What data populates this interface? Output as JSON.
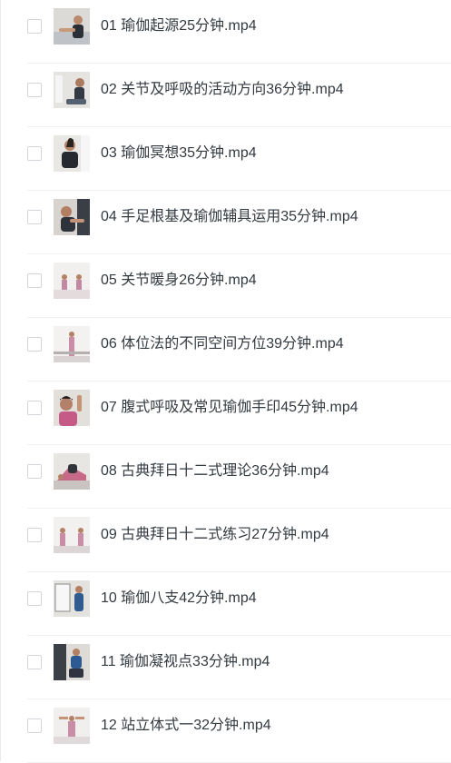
{
  "files": [
    {
      "name": "01 瑜伽起源25分钟.mp4",
      "thumb": "yoga-video-thumbnail"
    },
    {
      "name": "02 关节及呼吸的活动方向36分钟.mp4",
      "thumb": "yoga-video-thumbnail"
    },
    {
      "name": "03 瑜伽冥想35分钟.mp4",
      "thumb": "yoga-video-thumbnail"
    },
    {
      "name": "04 手足根基及瑜伽辅具运用35分钟.mp4",
      "thumb": "yoga-video-thumbnail"
    },
    {
      "name": "05 关节暖身26分钟.mp4",
      "thumb": "yoga-video-thumbnail"
    },
    {
      "name": "06 体位法的不同空间方位39分钟.mp4",
      "thumb": "yoga-video-thumbnail"
    },
    {
      "name": "07 腹式呼吸及常见瑜伽手印45分钟.mp4",
      "thumb": "yoga-video-thumbnail"
    },
    {
      "name": "08 古典拜日十二式理论36分钟.mp4",
      "thumb": "yoga-video-thumbnail"
    },
    {
      "name": "09 古典拜日十二式练习27分钟.mp4",
      "thumb": "yoga-video-thumbnail"
    },
    {
      "name": "10 瑜伽八支42分钟.mp4",
      "thumb": "yoga-video-thumbnail"
    },
    {
      "name": "11 瑜伽凝视点33分钟.mp4",
      "thumb": "yoga-video-thumbnail"
    },
    {
      "name": "12 站立体式一32分钟.mp4",
      "thumb": "yoga-video-thumbnail"
    }
  ]
}
